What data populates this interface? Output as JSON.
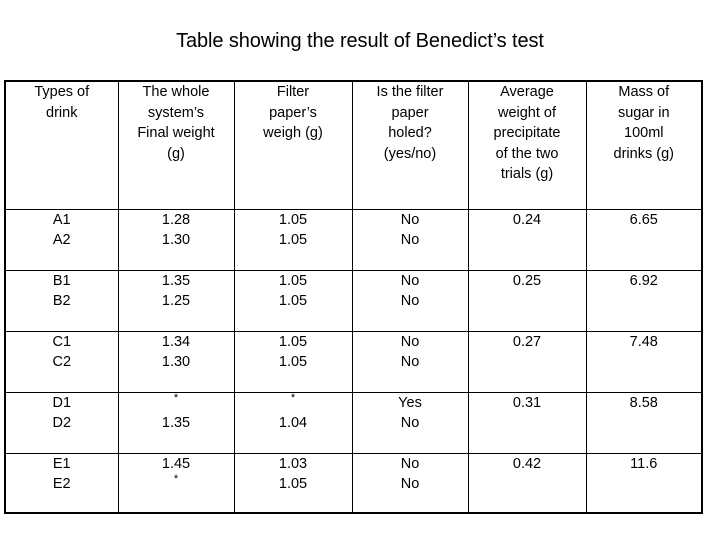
{
  "slide": {
    "title": "Table showing the result of Benedict’s test"
  },
  "table": {
    "headers": [
      "Types of drink",
      "The whole system’s Final weight (g)",
      "Filter paper’s weigh (g)",
      "Is the filter paper holed? (yes/no)",
      "Average weight of precipitate of the two trials (g)",
      "Mass of sugar in 100ml drinks (g)"
    ],
    "header_lines": [
      [
        "Types of",
        "drink"
      ],
      [
        "The whole",
        "system’s",
        "Final weight",
        "(g)"
      ],
      [
        "Filter",
        "paper’s",
        "weigh (g)"
      ],
      [
        "Is the filter",
        "paper",
        "holed?",
        "(yes/no)"
      ],
      [
        "Average",
        "weight of",
        "precipitate",
        "of the two",
        "trials (g)"
      ],
      [
        "Mass of",
        "sugar in",
        "100ml",
        "drinks (g)"
      ]
    ],
    "rows": [
      {
        "drink": [
          "A1",
          "A2"
        ],
        "final_weight": [
          "1.28",
          "1.30"
        ],
        "filter_paper_weight": [
          "1.05",
          "1.05"
        ],
        "holed": [
          "No",
          "No"
        ],
        "avg_precipitate": "0.24",
        "sugar_mass": "6.65"
      },
      {
        "drink": [
          "B1",
          "B2"
        ],
        "final_weight": [
          "1.35",
          "1.25"
        ],
        "filter_paper_weight": [
          "1.05",
          "1.05"
        ],
        "holed": [
          "No",
          "No"
        ],
        "avg_precipitate": "0.25",
        "sugar_mass": "6.92"
      },
      {
        "drink": [
          "C1",
          "C2"
        ],
        "final_weight": [
          "1.34",
          "1.30"
        ],
        "filter_paper_weight": [
          "1.05",
          "1.05"
        ],
        "holed": [
          "No",
          "No"
        ],
        "avg_precipitate": "0.27",
        "sugar_mass": "7.48"
      },
      {
        "drink": [
          "D1",
          "D2"
        ],
        "final_weight": [
          "*",
          "1.35"
        ],
        "filter_paper_weight": [
          "*",
          "1.04"
        ],
        "holed": [
          "Yes",
          "No"
        ],
        "avg_precipitate": "0.31",
        "sugar_mass": "8.58"
      },
      {
        "drink": [
          "E1",
          "E2"
        ],
        "final_weight": [
          "1.45",
          "*"
        ],
        "filter_paper_weight": [
          "1.03",
          "1.05"
        ],
        "holed": [
          "No",
          "No"
        ],
        "avg_precipitate": "0.42",
        "sugar_mass": "11.6"
      }
    ]
  },
  "colors": {
    "background": "#ffffff",
    "text": "#000000",
    "border": "#000000"
  }
}
